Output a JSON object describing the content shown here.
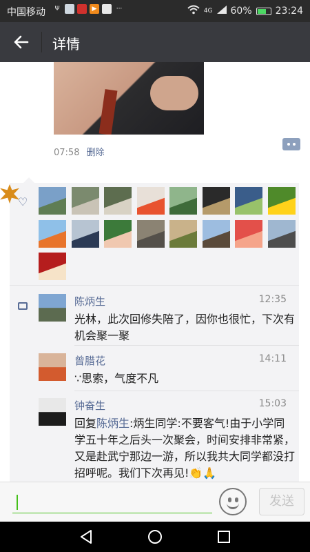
{
  "status_bar": {
    "carrier": "中国移动",
    "network": "4G",
    "battery": "60%",
    "time": "23:24"
  },
  "header": {
    "title": "详情"
  },
  "post": {
    "time": "07:58",
    "delete_label": "删除"
  },
  "likes": {
    "avatars": [
      {
        "color": "#7aa0c8",
        "accent": "#5f7d54"
      },
      {
        "color": "#7b8a6e",
        "accent": "#c9c3b6"
      },
      {
        "color": "#5d6d4f",
        "accent": "#d8d2c4"
      },
      {
        "color": "#e8e0d8",
        "accent": "#e8532f"
      },
      {
        "color": "#8fb58b",
        "accent": "#3e6b3a"
      },
      {
        "color": "#2a2a2a",
        "accent": "#b59a6a"
      },
      {
        "color": "#3a5d8a",
        "accent": "#98c26a"
      },
      {
        "color": "#4f8a2a",
        "accent": "#ffd21a"
      },
      {
        "color": "#8fc0e8",
        "accent": "#e8742b"
      },
      {
        "color": "#b7c4d2",
        "accent": "#2b3a55"
      },
      {
        "color": "#3c7a3a",
        "accent": "#f0c8b0"
      },
      {
        "color": "#8b8373",
        "accent": "#54504a"
      },
      {
        "color": "#c9b28a",
        "accent": "#6b7b3a"
      },
      {
        "color": "#9dbde0",
        "accent": "#5a4a3a"
      },
      {
        "color": "#e3504a",
        "accent": "#f5a48a"
      },
      {
        "color": "#9fb7d0",
        "accent": "#4d4d4d"
      },
      {
        "color": "#b51d1d",
        "accent": "#f6e3c8"
      }
    ]
  },
  "comments": [
    {
      "name": "陈炳生",
      "time": "12:35",
      "text": "光林，此次回修失陪了，因你也很忙，下次有机会聚一聚",
      "avatar": {
        "color": "#7fa6d2",
        "accent": "#5c6b50"
      }
    },
    {
      "name": "曾腊花",
      "time": "14:11",
      "text": "∵思索，气度不凡",
      "avatar": {
        "color": "#d9b49a",
        "accent": "#d35b2e"
      }
    },
    {
      "name": "钟奋生",
      "time": "15:03",
      "prefix": "回复",
      "mention": "陈炳生",
      "text": ":炳生同学:不要客气!由于小学同学五十年之后头一次聚会，时间安排非常紧，又是赴武宁那边一游，所以我共大同学都没打招呼呢。我们下次再见!👏🙏",
      "avatar": {
        "color": "#e8e8e8",
        "accent": "#1c1c1c"
      }
    }
  ],
  "input_bar": {
    "value": "",
    "send_label": "发送"
  }
}
